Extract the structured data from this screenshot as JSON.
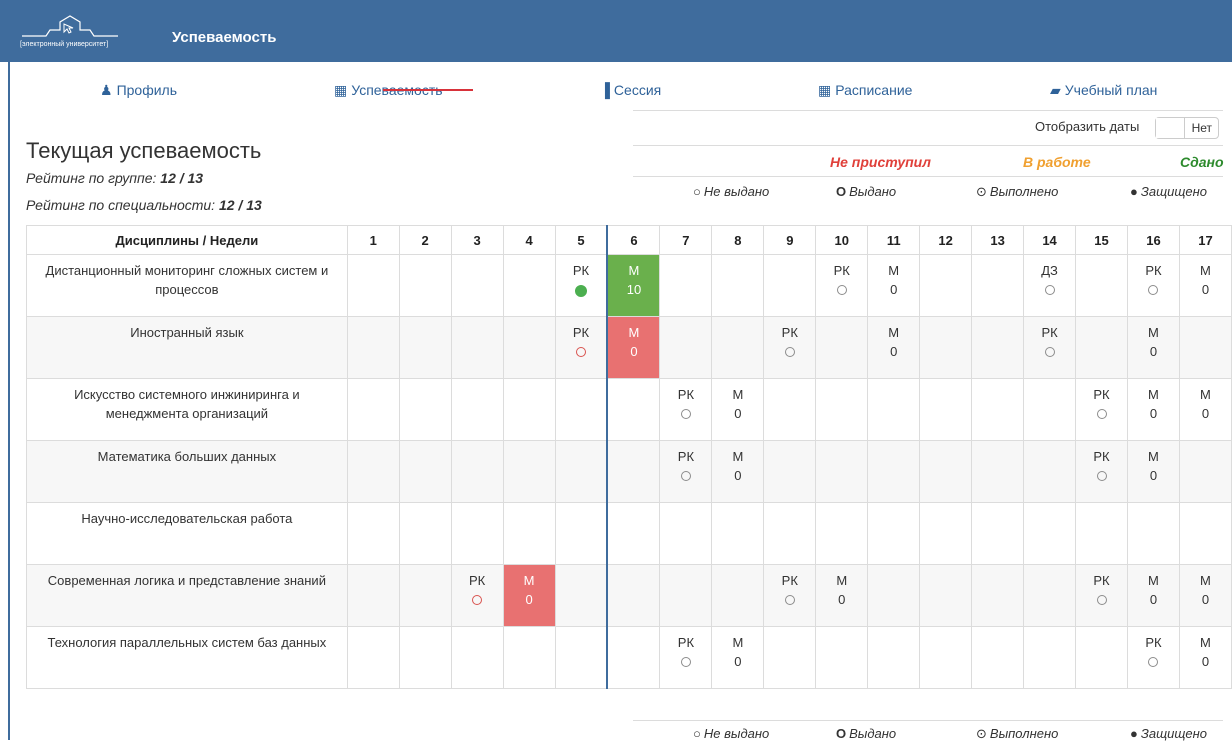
{
  "header": {
    "logo_caption": "[электронный университет]",
    "title": "Успеваемость"
  },
  "nav": [
    {
      "icon": "user-icon",
      "glyph": "♟",
      "label": "Профиль"
    },
    {
      "icon": "grid-icon",
      "glyph": "▦",
      "label": "Успеваемость"
    },
    {
      "icon": "bar-chart-icon",
      "glyph": "▐",
      "label": "Сессия"
    },
    {
      "icon": "calendar-icon",
      "glyph": "▦",
      "label": "Расписание"
    },
    {
      "icon": "book-icon",
      "glyph": "▰",
      "label": "Учебный план"
    }
  ],
  "page": {
    "heading": "Текущая успеваемость",
    "rating_group_label": "Рейтинг по группе:",
    "rating_group_value": "12 / 13",
    "rating_spec_label": "Рейтинг по специальности:",
    "rating_spec_value": "12 / 13"
  },
  "dates_toggle": {
    "label": "Отобразить даты",
    "value": "Нет"
  },
  "status_legend": {
    "not_started": "Не приступил",
    "in_progress": "В работе",
    "done": "Сдано",
    "colors": {
      "not_started": "#e0403a",
      "in_progress": "#f0a030",
      "done": "#2e8b2e"
    }
  },
  "legend": {
    "not_issued": {
      "sym": "○",
      "label": "Не выдано"
    },
    "issued": {
      "sym": "O",
      "label": "Выдано"
    },
    "completed": {
      "sym": "⊙",
      "label": "Выполнено"
    },
    "defended": {
      "sym": "●",
      "label": "Защищено"
    }
  },
  "table": {
    "header": "Дисциплины / Недели",
    "weeks": [
      "1",
      "2",
      "3",
      "4",
      "5",
      "6",
      "7",
      "8",
      "9",
      "10",
      "11",
      "12",
      "13",
      "14",
      "15",
      "16",
      "17"
    ],
    "rows": [
      {
        "name": "Дистанционный мониторинг сложных систем и процессов",
        "cells": {
          "5": {
            "t": "РК",
            "m": "filled"
          },
          "6": {
            "t": "М",
            "v": "10",
            "bg": "green"
          },
          "10": {
            "t": "РК",
            "m": "circle"
          },
          "11": {
            "t": "М",
            "v": "0"
          },
          "14": {
            "t": "ДЗ",
            "m": "circle"
          },
          "16": {
            "t": "РК",
            "m": "circle"
          },
          "17": {
            "t": "М",
            "v": "0"
          }
        }
      },
      {
        "name": "Иностранный язык",
        "cells": {
          "5": {
            "t": "РК",
            "m": "red"
          },
          "6": {
            "t": "М",
            "v": "0",
            "bg": "red"
          },
          "9": {
            "t": "РК",
            "m": "circle"
          },
          "11": {
            "t": "М",
            "v": "0"
          },
          "14": {
            "t": "РК",
            "m": "circle"
          },
          "16": {
            "t": "М",
            "v": "0"
          }
        }
      },
      {
        "name": "Искусство системного инжиниринга и менеджмента организаций",
        "cells": {
          "7": {
            "t": "РК",
            "m": "circle"
          },
          "8": {
            "t": "М",
            "v": "0"
          },
          "15": {
            "t": "РК",
            "m": "circle"
          },
          "16": {
            "t": "М",
            "v": "0"
          },
          "17": {
            "t": "М",
            "v": "0"
          }
        }
      },
      {
        "name": "Математика больших данных",
        "cells": {
          "7": {
            "t": "РК",
            "m": "circle"
          },
          "8": {
            "t": "М",
            "v": "0"
          },
          "15": {
            "t": "РК",
            "m": "circle"
          },
          "16": {
            "t": "М",
            "v": "0"
          }
        }
      },
      {
        "name": "Научно-исследовательская работа",
        "cells": {}
      },
      {
        "name": "Современная логика и представление знаний",
        "cells": {
          "3": {
            "t": "РК",
            "m": "red"
          },
          "4": {
            "t": "М",
            "v": "0",
            "bg": "red"
          },
          "9": {
            "t": "РК",
            "m": "circle"
          },
          "10": {
            "t": "М",
            "v": "0"
          },
          "15": {
            "t": "РК",
            "m": "circle"
          },
          "16": {
            "t": "М",
            "v": "0"
          },
          "17": {
            "t": "М",
            "v": "0"
          }
        }
      },
      {
        "name": "Технология параллельных систем баз данных",
        "cells": {
          "7": {
            "t": "РК",
            "m": "circle"
          },
          "8": {
            "t": "М",
            "v": "0"
          },
          "16": {
            "t": "РК",
            "m": "circle"
          },
          "17": {
            "t": "М",
            "v": "0"
          }
        }
      }
    ]
  }
}
